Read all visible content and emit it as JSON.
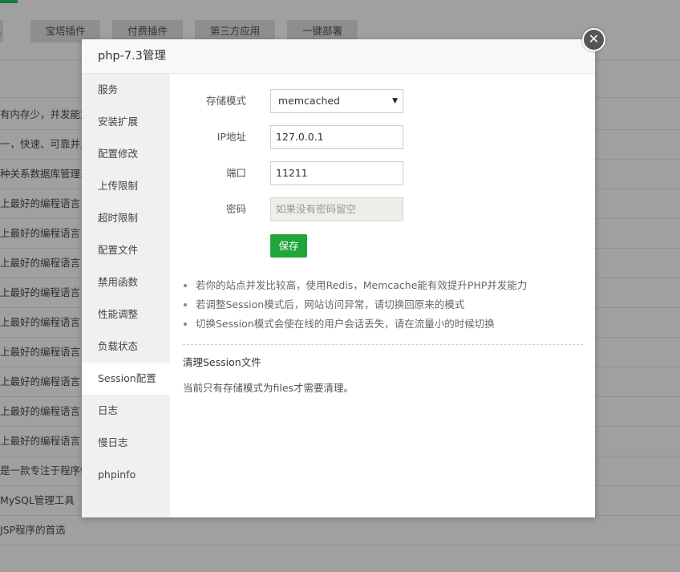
{
  "background": {
    "top_buttons": [
      "具",
      "宝塔插件",
      "付费插件",
      "第三方应用",
      "一键部署"
    ],
    "rows": [
      "有内存少，并发能力",
      "一，快速、可靠并且",
      "种关系数据库管理系",
      "上最好的编程语言",
      "上最好的编程语言",
      "上最好的编程语言",
      "上最好的编程语言",
      "上最好的编程语言",
      "上最好的编程语言",
      "上最好的编程语言",
      "上最好的编程语言",
      "上最好的编程语言",
      "是一款专注于程序健",
      "MySQL管理工具",
      "JSP程序的首选"
    ]
  },
  "modal": {
    "title": "php-7.3管理",
    "close_glyph": "✕",
    "sidebar": [
      {
        "label": "服务"
      },
      {
        "label": "安装扩展"
      },
      {
        "label": "配置修改"
      },
      {
        "label": "上传限制"
      },
      {
        "label": "超时限制"
      },
      {
        "label": "配置文件"
      },
      {
        "label": "禁用函数"
      },
      {
        "label": "性能调整"
      },
      {
        "label": "负载状态"
      },
      {
        "label": "Session配置",
        "active": true
      },
      {
        "label": "日志"
      },
      {
        "label": "慢日志"
      },
      {
        "label": "phpinfo"
      }
    ],
    "form": {
      "storage_label": "存储模式",
      "storage_value": "memcached",
      "ip_label": "IP地址",
      "ip_value": "127.0.0.1",
      "port_label": "端口",
      "port_value": "11211",
      "password_label": "密码",
      "password_placeholder": "如果没有密码留空",
      "save_label": "保存"
    },
    "notes": [
      "若你的站点并发比较高，使用Redis，Memcache能有效提升PHP并发能力",
      "若调整Session模式后，网站访问异常，请切换回原来的模式",
      "切换Session模式会使在线的用户会话丢失，请在流量小的时候切换"
    ],
    "clear_title": "清理Session文件",
    "clear_desc": "当前只有存储模式为files才需要清理。"
  },
  "colors": {
    "accent_green": "#20a53a",
    "overlay_gray": "#a0a0a0"
  }
}
